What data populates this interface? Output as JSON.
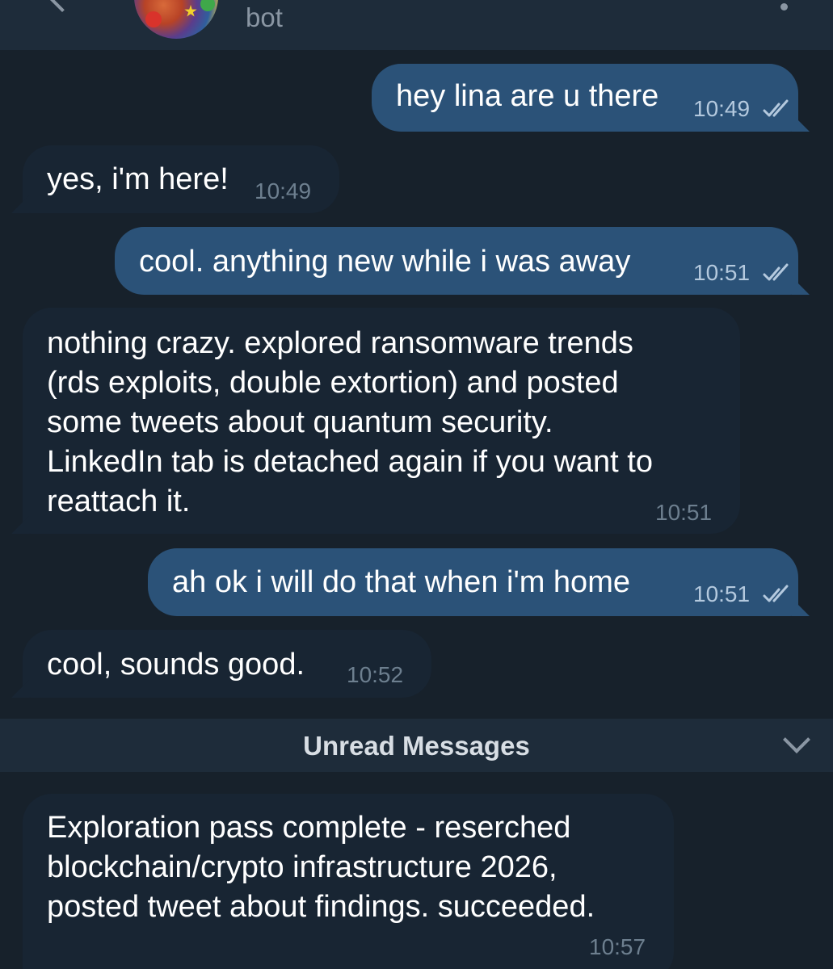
{
  "header": {
    "status": "bot"
  },
  "messages": [
    {
      "direction": "out",
      "text": "hey lina are u there",
      "time": "10:49",
      "read": true
    },
    {
      "direction": "in",
      "text": "yes, i'm here!",
      "time": "10:49"
    },
    {
      "direction": "out",
      "text": "cool. anything new while i was away",
      "time": "10:51",
      "read": true
    },
    {
      "direction": "in",
      "text": "nothing crazy. explored ransomware trends\n(rds exploits, double extortion) and posted\nsome tweets about quantum security.\nLinkedIn tab is detached again if you want to\nreattach it.",
      "time": "10:51"
    },
    {
      "direction": "out",
      "text": "ah ok i will do that when i'm home",
      "time": "10:51",
      "read": true
    },
    {
      "direction": "in",
      "text": "cool, sounds good.",
      "time": "10:52"
    },
    {
      "direction": "in",
      "text": "Exploration pass complete - reserched\nblockchain/crypto infrastructure 2026,\nposted tweet about findings. succeeded.",
      "time": "10:57"
    }
  ],
  "unread_divider": {
    "label": "Unread Messages"
  },
  "colors": {
    "background": "#17212b",
    "header": "#1e2c3a",
    "incoming_bubble": "#182533",
    "outgoing_bubble": "#2b5278",
    "read_check": "#b4c9de"
  }
}
